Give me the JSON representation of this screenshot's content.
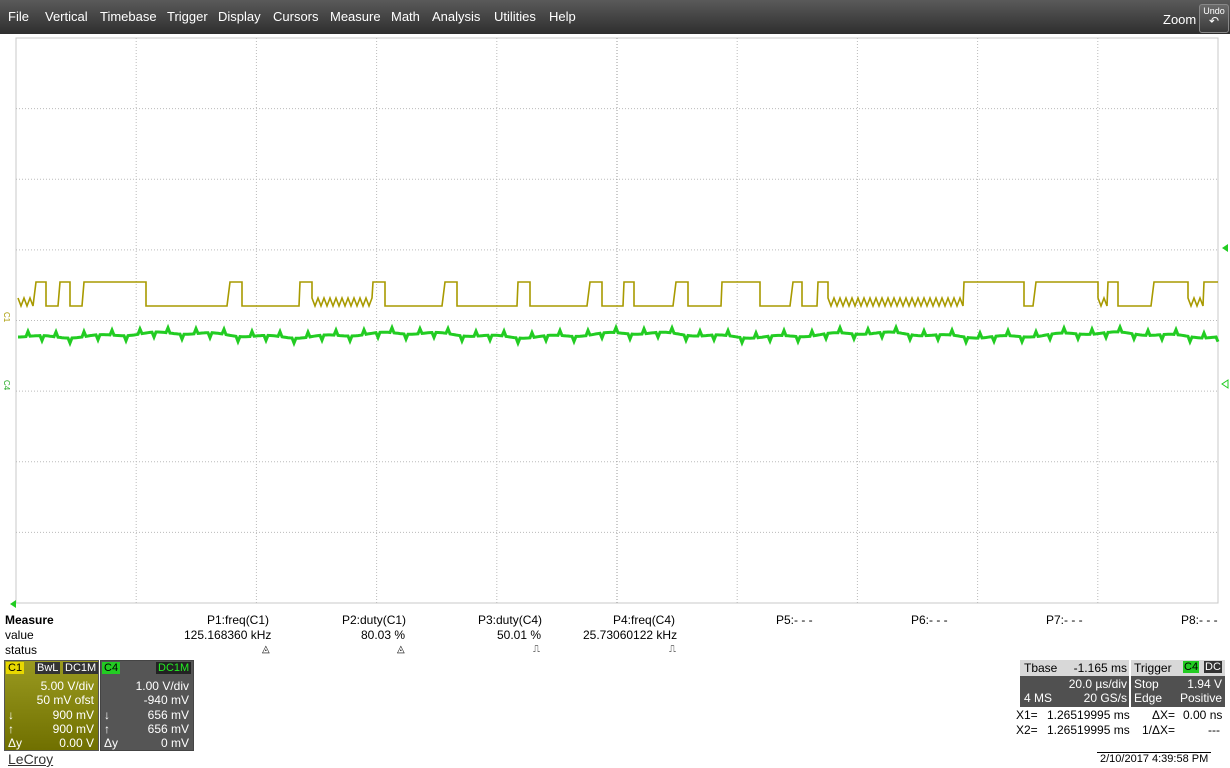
{
  "menu": [
    "File",
    "Vertical",
    "Timebase",
    "Trigger",
    "Display",
    "Cursors",
    "Measure",
    "Math",
    "Analysis",
    "Utilities",
    "Help"
  ],
  "toolbar": {
    "zoom": "Zoom",
    "undo": "Undo",
    "undo_icon": "undo-arrow-icon"
  },
  "channel_markers": {
    "c1": "C1",
    "c4": "C4"
  },
  "colors": {
    "c1": "#b5a800",
    "c4": "#22cc22",
    "grid_bg": "#ffffff",
    "menubar": "#3a3a3a"
  },
  "measure": {
    "header": "Measure",
    "row_value": "value",
    "row_status": "status",
    "params": [
      {
        "label": "P1:freq(C1)",
        "value": "125.168360 kHz",
        "status": "warning-icon"
      },
      {
        "label": "P2:duty(C1)",
        "value": "80.03 %",
        "status": "warning-icon"
      },
      {
        "label": "P3:duty(C4)",
        "value": "50.01 %",
        "status": "pulse-icon"
      },
      {
        "label": "P4:freq(C4)",
        "value": "25.73060122 kHz",
        "status": "pulse-icon"
      },
      {
        "label": "P5:- - -",
        "value": "",
        "status": ""
      },
      {
        "label": "P6:- - -",
        "value": "",
        "status": ""
      },
      {
        "label": "P7:- - -",
        "value": "",
        "status": ""
      },
      {
        "label": "P8:- - -",
        "value": "",
        "status": ""
      }
    ]
  },
  "c1": {
    "tag": "C1",
    "bw": "BwL",
    "coupling": "DC1M",
    "vdiv": "5.00 V/div",
    "offset": "50 mV ofst",
    "cur1": "900 mV",
    "cur2": "900 mV",
    "dy_label": "Δy",
    "dy": "0.00 V"
  },
  "c4": {
    "tag": "C4",
    "coupling": "DC1M",
    "vdiv": "1.00 V/div",
    "offset": "-940 mV",
    "cur1": "656 mV",
    "cur2": "656 mV",
    "dy_label": "Δy",
    "dy": "0 mV"
  },
  "timebase": {
    "label": "Tbase",
    "delay": "-1.165 ms",
    "tdiv": "20.0 µs/div",
    "samples": "4 MS",
    "rate": "20 GS/s"
  },
  "trigger": {
    "label": "Trigger",
    "src": "C4",
    "coupling": "DC",
    "mode": "Stop",
    "level": "1.94 V",
    "type": "Edge",
    "slope": "Positive"
  },
  "cursors": {
    "x1_label": "X1=",
    "x1": "1.26519995 ms",
    "dx_label": "ΔX=",
    "dx": "0.00 ns",
    "x2_label": "X2=",
    "x2": "1.26519995 ms",
    "idx_label": "1/ΔX=",
    "idx": "---"
  },
  "brand": "LeCroy",
  "datetime": "2/10/2017 4:39:58 PM"
}
